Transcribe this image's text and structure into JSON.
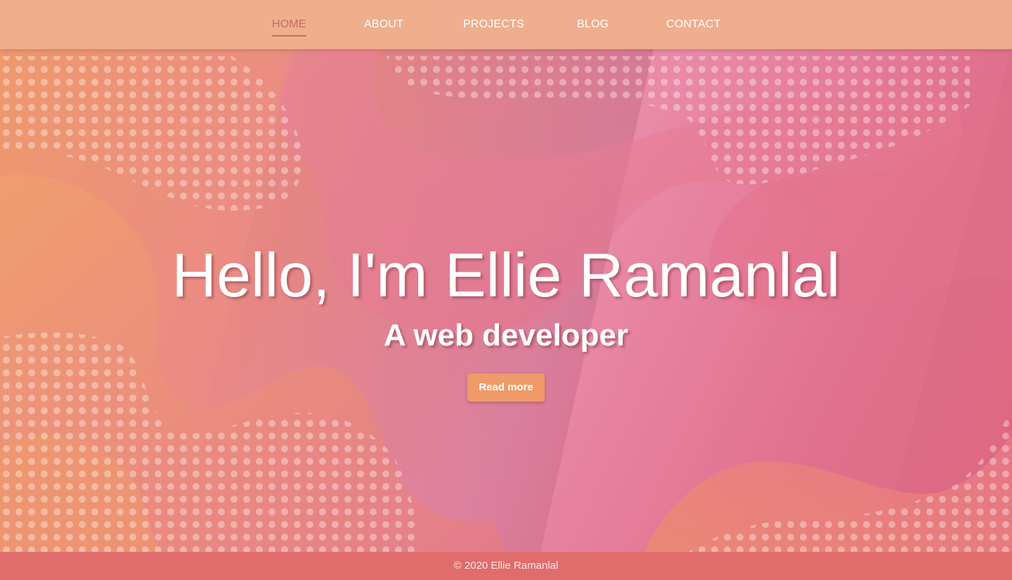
{
  "nav": {
    "items": [
      {
        "label": "HOME",
        "active": true
      },
      {
        "label": "ABOUT",
        "active": false
      },
      {
        "label": "PROJECTS",
        "active": false
      },
      {
        "label": "BLOG",
        "active": false
      },
      {
        "label": "CONTACT",
        "active": false
      }
    ]
  },
  "hero": {
    "title": "Hello, I'm Ellie Ramanlal",
    "subtitle": "A web developer",
    "button_label": "Read more"
  },
  "footer": {
    "text": "© 2020 Ellie Ramanlal"
  },
  "colors": {
    "nav_bg": "#eeb08c",
    "active_nav": "#c46a6a",
    "button": "#ef9a68",
    "footer_bg": "#e06c6c",
    "text": "#ffffff"
  }
}
